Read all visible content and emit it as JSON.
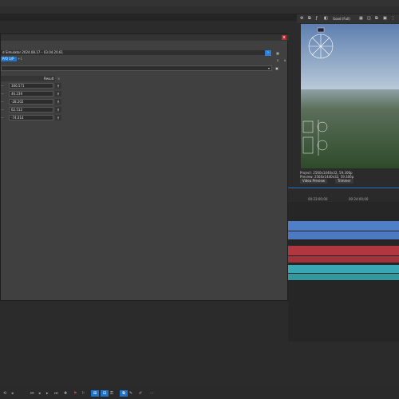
{
  "dialog": {
    "close_label": "x",
    "path_text": "d Simulator 2024.08.17 – 03.04.20.61",
    "tag_label": "P/O 1/P",
    "tag_suffix": "+1",
    "table": {
      "header": "Result",
      "rows": [
        {
          "value": "306.571"
        },
        {
          "value": "46.239"
        },
        {
          "value": "-28.202"
        },
        {
          "value": "62.512"
        },
        {
          "value": "-74.014"
        }
      ]
    }
  },
  "preview": {
    "toolbar_mode": "Good (Full)",
    "info": {
      "project": "Project:  2560x1440x32, 59.306p",
      "preview": "Preview:  2560x1440x32, 59.306p",
      "video_preview_tab": "Video Preview",
      "trimmer_tab": "Trimmer"
    }
  },
  "timeline": {
    "timecodes": [
      "00:23:00;00",
      "00:24:00;00"
    ]
  },
  "colors": {
    "accent": "#1f73c9",
    "close": "#b43232",
    "track_blue": "#4f7fc8",
    "track_red": "#b0363f",
    "track_teal": "#3aa7b4"
  }
}
